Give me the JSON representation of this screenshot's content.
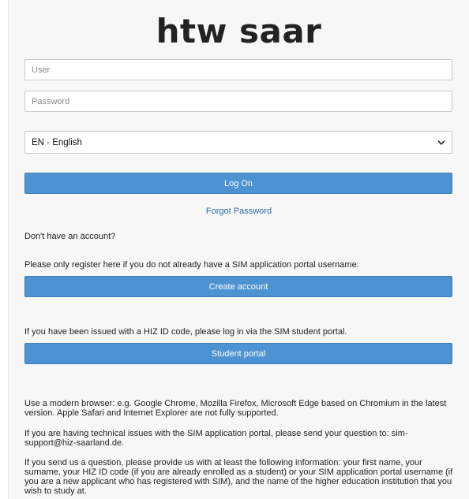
{
  "logo": {
    "text": "htw saar"
  },
  "login": {
    "user_placeholder": "User",
    "password_placeholder": "Password",
    "language_selected": "EN - English",
    "logon_label": "Log On",
    "forgot_password_label": "Forgot Password"
  },
  "register": {
    "no_account_text": "Don't have an account?",
    "register_info": "Please only register here if you do not already have a SIM application portal username.",
    "create_account_label": "Create account"
  },
  "student": {
    "info": "If you have been issued with a HIZ ID code, please log in via the SIM student portal.",
    "portal_label": "Student portal"
  },
  "notes": {
    "browser": "Use a modern browser: e.g. Google Chrome, Mozilla Firefox, Microsoft Edge based on Chromium in the latest version. Apple Safari and Internet Explorer are not fully supported.",
    "technical": "If you are having technical issues with the SIM application portal, please send your question to: sim-support@hiz-saarland.de.",
    "question": "If you send us a question, please provide us with at least the following information: your first name, your surname, your HIZ ID code (if you are already enrolled as a student) or your SIM application portal username (if you are a new applicant who has registered with SIM), and the name of the higher education institution that you wish to study at."
  },
  "icons": {
    "select_chevron": "chevron-down-icon"
  },
  "colors": {
    "button": "#4e93d1",
    "link": "#2a6fb0",
    "background": "#f7f7f7"
  }
}
